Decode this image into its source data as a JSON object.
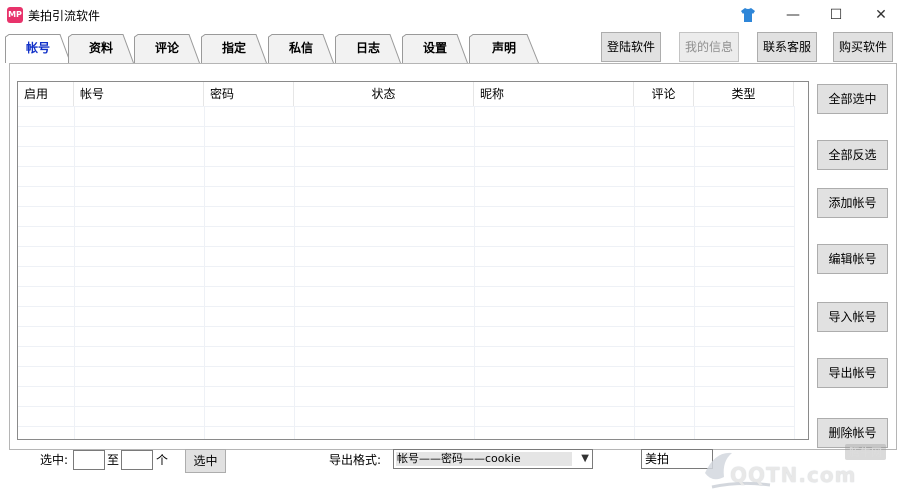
{
  "window": {
    "title": "美拍引流软件",
    "app_icon_text": "MP",
    "minimize_glyph": "—",
    "maximize_glyph": "☐",
    "close_glyph": "✕"
  },
  "tabs": [
    {
      "label": "帐号",
      "active": true
    },
    {
      "label": "资料",
      "active": false
    },
    {
      "label": "评论",
      "active": false
    },
    {
      "label": "指定",
      "active": false
    },
    {
      "label": "私信",
      "active": false
    },
    {
      "label": "日志",
      "active": false
    },
    {
      "label": "设置",
      "active": false
    },
    {
      "label": "声明",
      "active": false
    }
  ],
  "top_buttons": {
    "login": "登陆软件",
    "my_info": "我的信息",
    "contact": "联系客服",
    "buy": "购买软件"
  },
  "table": {
    "columns": [
      "启用",
      "帐号",
      "密码",
      "状态",
      "昵称",
      "评论",
      "类型"
    ],
    "rows": []
  },
  "side_buttons": {
    "select_all": "全部选中",
    "invert": "全部反选",
    "add": "添加帐号",
    "edit": "编辑帐号",
    "import": "导入帐号",
    "export": "导出帐号",
    "delete": "删除帐号"
  },
  "bottom": {
    "select_label": "选中:",
    "from_value": "",
    "to_label": "至",
    "to_value": "",
    "unit_label": "个",
    "select_button": "选中",
    "export_format_label": "导出格式:",
    "export_format_value": "帐号——密码——cookie",
    "platform_value": "美拍"
  },
  "watermark": {
    "brand": "QQTN.com",
    "sub": "腾牛网"
  },
  "colors": {
    "active_tab": "#1030c8",
    "app_icon": "#e8336b",
    "skin_icon": "#2e86d8"
  }
}
